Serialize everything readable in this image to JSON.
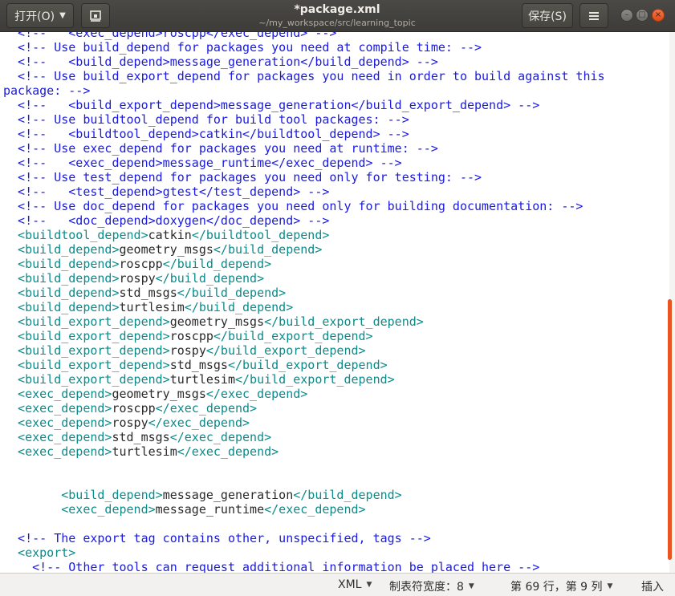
{
  "header": {
    "open_label": "打开(O)",
    "save_label": "保存(S)",
    "title": "*package.xml",
    "subtitle": "~/my_workspace/src/learning_topic"
  },
  "editor": {
    "lines": [
      [
        {
          "k": "c",
          "s": "  <!--   <exec_depend>roscpp</exec_depend> -->"
        }
      ],
      [
        {
          "k": "c",
          "s": "  <!-- Use build_depend for packages you need at compile time: -->"
        }
      ],
      [
        {
          "k": "c",
          "s": "  <!--   <build_depend>message_generation</build_depend> -->"
        }
      ],
      [
        {
          "k": "c",
          "s": "  <!-- Use build_export_depend for packages you need in order to build against this"
        }
      ],
      [
        {
          "k": "c",
          "s": "package: -->"
        }
      ],
      [
        {
          "k": "c",
          "s": "  <!--   <build_export_depend>message_generation</build_export_depend> -->"
        }
      ],
      [
        {
          "k": "c",
          "s": "  <!-- Use buildtool_depend for build tool packages: -->"
        }
      ],
      [
        {
          "k": "c",
          "s": "  <!--   <buildtool_depend>catkin</buildtool_depend> -->"
        }
      ],
      [
        {
          "k": "c",
          "s": "  <!-- Use exec_depend for packages you need at runtime: -->"
        }
      ],
      [
        {
          "k": "c",
          "s": "  <!--   <exec_depend>message_runtime</exec_depend> -->"
        }
      ],
      [
        {
          "k": "c",
          "s": "  <!-- Use test_depend for packages you need only for testing: -->"
        }
      ],
      [
        {
          "k": "c",
          "s": "  <!--   <test_depend>gtest</test_depend> -->"
        }
      ],
      [
        {
          "k": "c",
          "s": "  <!-- Use doc_depend for packages you need only for building documentation: -->"
        }
      ],
      [
        {
          "k": "c",
          "s": "  <!--   <doc_depend>doxygen</doc_depend> -->"
        }
      ],
      [
        {
          "k": "t",
          "s": "  <buildtool_depend>"
        },
        {
          "k": "x",
          "s": "catkin"
        },
        {
          "k": "t",
          "s": "</buildtool_depend>"
        }
      ],
      [
        {
          "k": "t",
          "s": "  <build_depend>"
        },
        {
          "k": "x",
          "s": "geometry_msgs"
        },
        {
          "k": "t",
          "s": "</build_depend>"
        }
      ],
      [
        {
          "k": "t",
          "s": "  <build_depend>"
        },
        {
          "k": "x",
          "s": "roscpp"
        },
        {
          "k": "t",
          "s": "</build_depend>"
        }
      ],
      [
        {
          "k": "t",
          "s": "  <build_depend>"
        },
        {
          "k": "x",
          "s": "rospy"
        },
        {
          "k": "t",
          "s": "</build_depend>"
        }
      ],
      [
        {
          "k": "t",
          "s": "  <build_depend>"
        },
        {
          "k": "x",
          "s": "std_msgs"
        },
        {
          "k": "t",
          "s": "</build_depend>"
        }
      ],
      [
        {
          "k": "t",
          "s": "  <build_depend>"
        },
        {
          "k": "x",
          "s": "turtlesim"
        },
        {
          "k": "t",
          "s": "</build_depend>"
        }
      ],
      [
        {
          "k": "t",
          "s": "  <build_export_depend>"
        },
        {
          "k": "x",
          "s": "geometry_msgs"
        },
        {
          "k": "t",
          "s": "</build_export_depend>"
        }
      ],
      [
        {
          "k": "t",
          "s": "  <build_export_depend>"
        },
        {
          "k": "x",
          "s": "roscpp"
        },
        {
          "k": "t",
          "s": "</build_export_depend>"
        }
      ],
      [
        {
          "k": "t",
          "s": "  <build_export_depend>"
        },
        {
          "k": "x",
          "s": "rospy"
        },
        {
          "k": "t",
          "s": "</build_export_depend>"
        }
      ],
      [
        {
          "k": "t",
          "s": "  <build_export_depend>"
        },
        {
          "k": "x",
          "s": "std_msgs"
        },
        {
          "k": "t",
          "s": "</build_export_depend>"
        }
      ],
      [
        {
          "k": "t",
          "s": "  <build_export_depend>"
        },
        {
          "k": "x",
          "s": "turtlesim"
        },
        {
          "k": "t",
          "s": "</build_export_depend>"
        }
      ],
      [
        {
          "k": "t",
          "s": "  <exec_depend>"
        },
        {
          "k": "x",
          "s": "geometry_msgs"
        },
        {
          "k": "t",
          "s": "</exec_depend>"
        }
      ],
      [
        {
          "k": "t",
          "s": "  <exec_depend>"
        },
        {
          "k": "x",
          "s": "roscpp"
        },
        {
          "k": "t",
          "s": "</exec_depend>"
        }
      ],
      [
        {
          "k": "t",
          "s": "  <exec_depend>"
        },
        {
          "k": "x",
          "s": "rospy"
        },
        {
          "k": "t",
          "s": "</exec_depend>"
        }
      ],
      [
        {
          "k": "t",
          "s": "  <exec_depend>"
        },
        {
          "k": "x",
          "s": "std_msgs"
        },
        {
          "k": "t",
          "s": "</exec_depend>"
        }
      ],
      [
        {
          "k": "t",
          "s": "  <exec_depend>"
        },
        {
          "k": "x",
          "s": "turtlesim"
        },
        {
          "k": "t",
          "s": "</exec_depend>"
        }
      ],
      [
        {
          "k": "x",
          "s": " "
        }
      ],
      [
        {
          "k": "x",
          "s": " "
        }
      ],
      [
        {
          "k": "t",
          "s": "        <build_depend>"
        },
        {
          "k": "x",
          "s": "message_generation"
        },
        {
          "k": "t",
          "s": "</build_depend>"
        }
      ],
      [
        {
          "k": "t",
          "s": "        <exec_depend>"
        },
        {
          "k": "x",
          "s": "message_runtime"
        },
        {
          "k": "t",
          "s": "</exec_depend>"
        }
      ],
      [
        {
          "k": "x",
          "s": " "
        }
      ],
      [
        {
          "k": "c",
          "s": "  <!-- The export tag contains other, unspecified, tags -->"
        }
      ],
      [
        {
          "k": "t",
          "s": "  <export>"
        }
      ],
      [
        {
          "k": "c",
          "s": "    <!-- Other tools can request additional information be placed here -->"
        }
      ]
    ]
  },
  "statusbar": {
    "language": "XML",
    "tab_width": "制表符宽度：8",
    "position": "第 69 行，第 9 列",
    "insert_mode": "插入"
  },
  "colors": {
    "comment": "#1a1ae0",
    "tag": "#0d8a8a",
    "text": "#2a2a2a",
    "accent": "#e95420"
  },
  "icons": {
    "pin": "document-pin-icon",
    "menu": "hamburger-menu-icon",
    "minimize": "minimize-icon",
    "maximize": "maximize-icon",
    "close": "close-icon"
  }
}
